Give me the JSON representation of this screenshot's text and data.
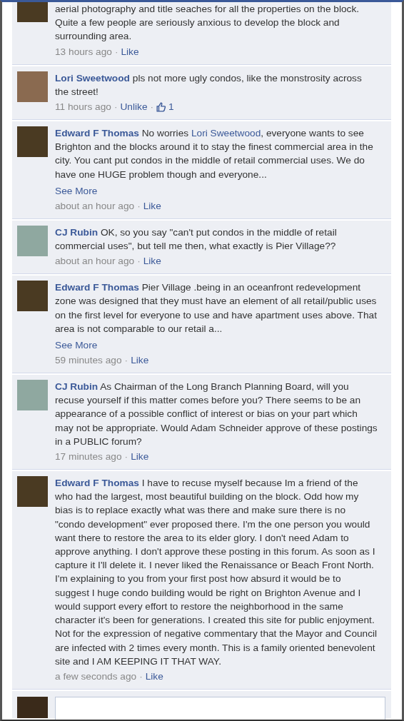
{
  "comments": [
    {
      "segments": [
        {
          "kind": "text",
          "text": "aerial photography and title seaches for all the properties on the block. Quite a few people are seriously anxious to develop the block and surrounding area."
        }
      ],
      "time": "13 hours ago",
      "separator": "·",
      "action": "Like",
      "cropped": true
    },
    {
      "author": "Lori Sweetwood",
      "segments": [
        {
          "kind": "text",
          "text": "pls not more ugly condos, like the monstrosity across the street!"
        }
      ],
      "time": "11 hours ago",
      "separator": "·",
      "action": "Unlike",
      "likes": "1"
    },
    {
      "author": "Edward F Thomas",
      "segments": [
        {
          "kind": "text",
          "text": "No worries "
        },
        {
          "kind": "mention",
          "text": "Lori Sweetwood"
        },
        {
          "kind": "text",
          "text": ", everyone wants to see Brighton and the blocks around it to stay the finest commercial area in the city. You cant put condos in the middle of retail commercial uses. We do have one HUGE problem though and everyone..."
        }
      ],
      "see_more": "See More",
      "time": "about an hour ago",
      "separator": "·",
      "action": "Like"
    },
    {
      "author": "CJ Rubin",
      "segments": [
        {
          "kind": "text",
          "text": "OK, so you say \"can't put condos in the middle of retail commercial uses\", but tell me then, what exactly is Pier Village??"
        }
      ],
      "time": "about an hour ago",
      "separator": "·",
      "action": "Like"
    },
    {
      "author": "Edward F Thomas",
      "segments": [
        {
          "kind": "text",
          "text": "Pier Village .being in an oceanfront redevelopment zone was designed that they must have an element of all retail/public uses on the first level for everyone to use and have apartment uses above. That area is not comparable to our retail a..."
        }
      ],
      "see_more": "See More",
      "time": "59 minutes ago",
      "separator": "·",
      "action": "Like"
    },
    {
      "author": "CJ Rubin",
      "segments": [
        {
          "kind": "text",
          "text": "As Chairman of the Long Branch Planning Board, will you recuse yourself if this matter comes before you? There seems to be an appearance of a possible conflict of interest or bias on your part which may not be appropriate. Would Adam Schneider approve of these postings in a PUBLIC forum?"
        }
      ],
      "time": "17 minutes ago",
      "separator": "·",
      "action": "Like"
    },
    {
      "author": "Edward F Thomas",
      "segments": [
        {
          "kind": "text",
          "text": "I have to recuse myself because Im a friend of the who had the largest, most beautiful building on the block. Odd how my bias is to replace exactly what was there and make sure there is no \"condo development\" ever proposed there. I'm the one person you would want there to restore the area to its elder glory. I don't need Adam to approve anything. I don't approve these posting in this forum. As soon as I capture it I'll delete it. I never liked the Renaissance or Beach Front North. I'm explaining to you from your first post how absurd it would be to suggest I huge condo building would be right on Brighton Avenue and I would support every effort to restore the neighborhood in the same character it's been for generations. I created this site for public enjoyment. Not for the expression of negative commentary that the Mayor and Council are infected with 2 times every month. This is a family oriented benevolent site and I AM KEEPING IT THAT WAY."
        }
      ],
      "time": "a few seconds ago",
      "separator": "·",
      "action": "Like"
    }
  ]
}
